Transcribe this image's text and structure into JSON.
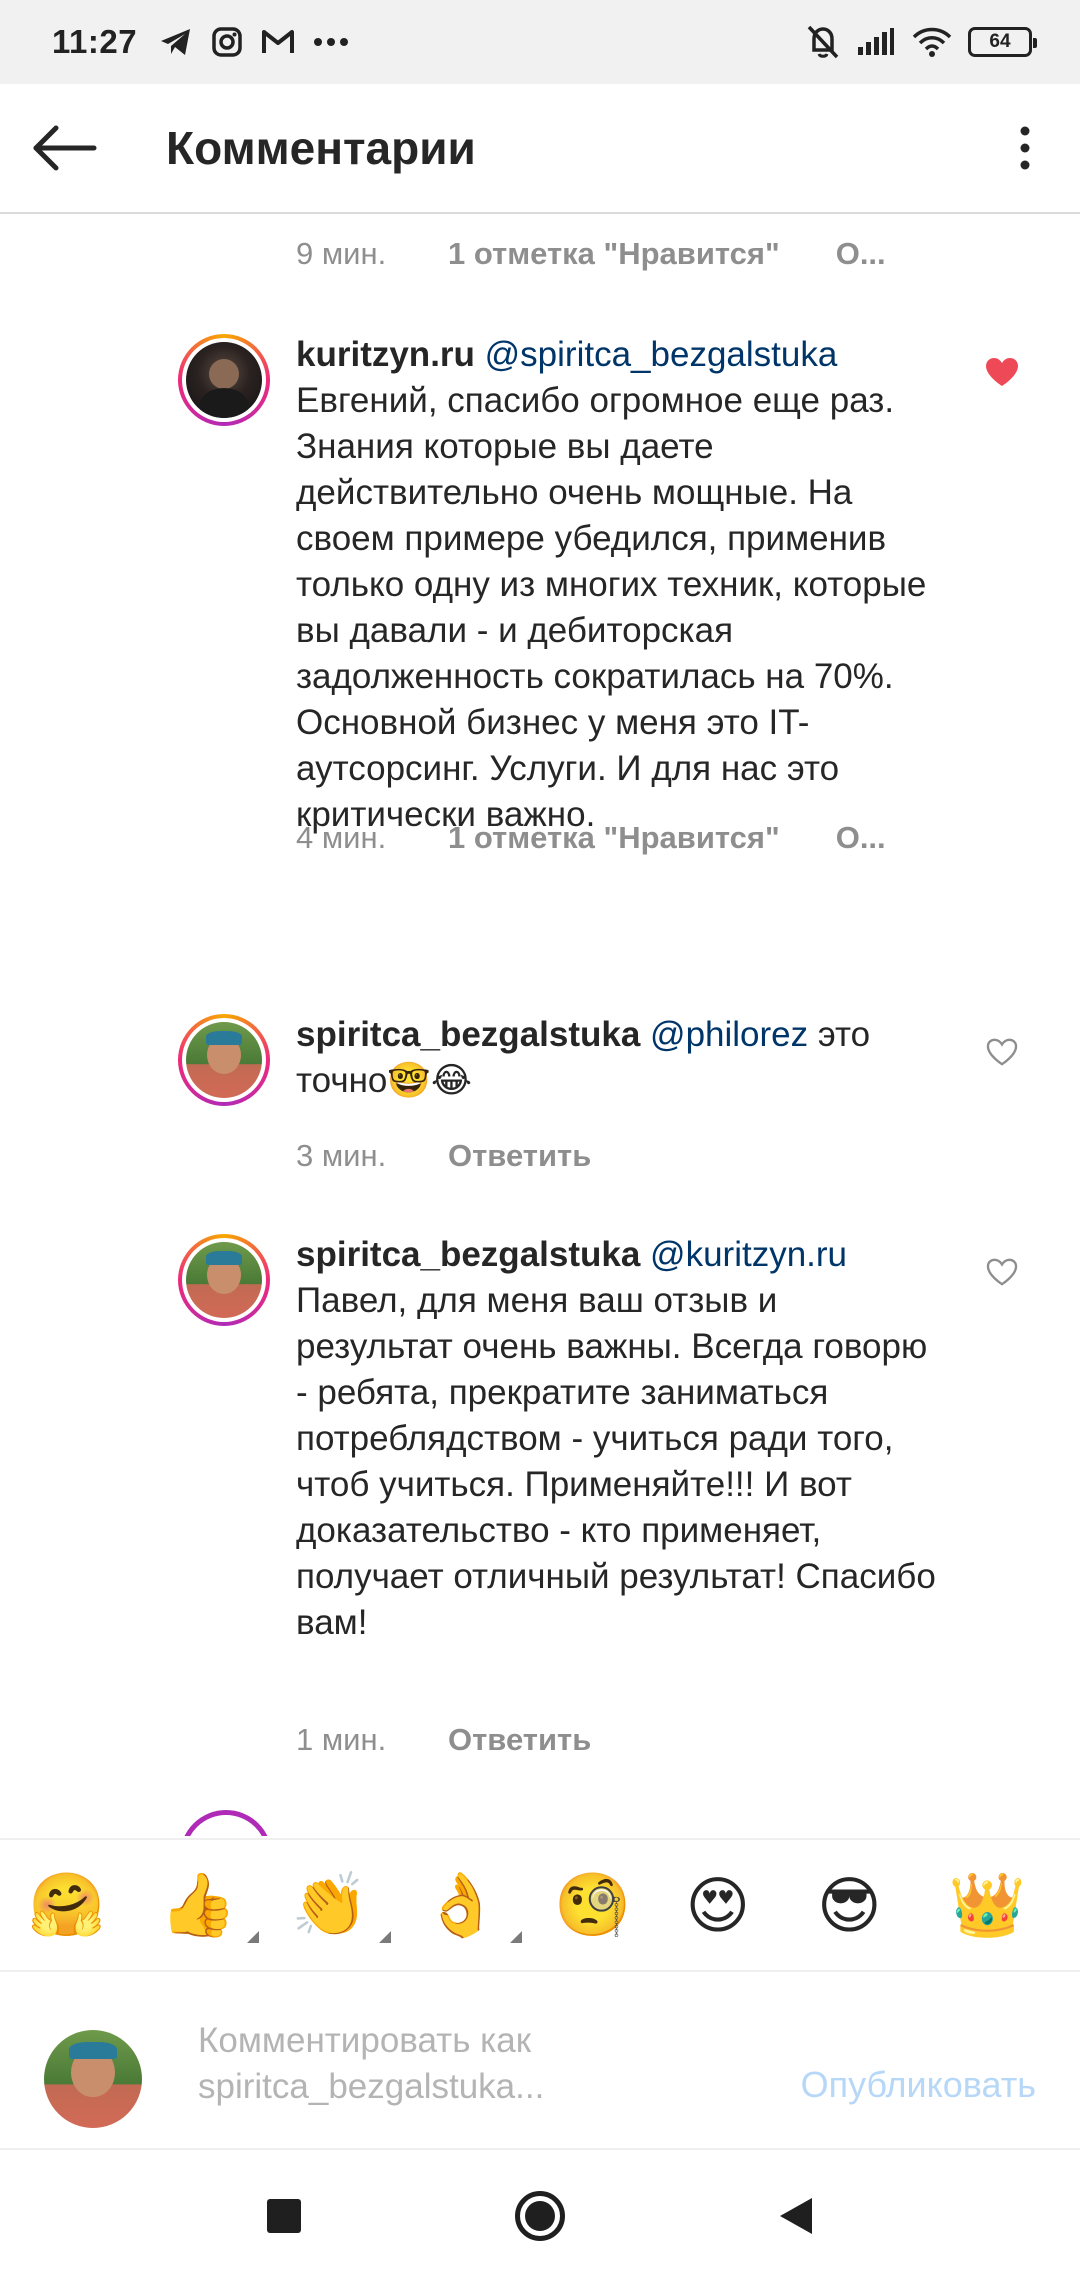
{
  "status": {
    "time": "11:27",
    "battery": "64",
    "left_icons": [
      "telegram-icon",
      "instagram-icon",
      "gmail-icon",
      "more-dots-icon"
    ],
    "right_icons": [
      "mute-bell-icon",
      "signal-icon",
      "wifi-icon",
      "battery-icon"
    ]
  },
  "header": {
    "title": "Комментарии"
  },
  "comments": [
    {
      "time": "9 мин.",
      "likes": "1 отметка \"Нравится\"",
      "action": "О..."
    },
    {
      "username": "kuritzyn.ru",
      "mention": "@spiritca_bezgalstuka",
      "text": "Евгений, спасибо огромное еще раз. Знания которые вы даете действительно очень мощные. На своем примере убедился, применив только одну из многих техник, которые вы давали - и дебиторская задолженность сократилась на 70%. Основной бизнес у меня это IT-аутсорсинг. Услуги. И для нас это критически важно.",
      "time": "4 мин.",
      "likes": "1 отметка \"Нравится\"",
      "action": "О...",
      "liked": true
    },
    {
      "username": "spiritca_bezgalstuka",
      "mention": "@philorez",
      "text": " это точно🤓😂",
      "time": "3 мин.",
      "action": "Ответить",
      "liked": false
    },
    {
      "username": "spiritca_bezgalstuka",
      "mention": "@kuritzyn.ru",
      "text": "Павел, для меня ваш отзыв и результат очень важны. Всегда говорю - ребята, прекратите заниматься потреблядством - учиться ради того, чтоб учиться. Применяйте!!! И вот доказательство - кто применяет, получает отличный результат! Спасибо вам!",
      "time": "1 мин.",
      "action": "Ответить",
      "liked": false
    }
  ],
  "emoji_bar": [
    "🤗",
    "👍",
    "👏",
    "👌",
    "🧐",
    "😍",
    "😎",
    "👑"
  ],
  "composer": {
    "placeholder": "Комментировать как spiritca_bezgalstuka...",
    "publish_label": "Опубликовать"
  },
  "colors": {
    "like_red": "#ed4956",
    "mention_blue": "#003569",
    "publish_disabled": "#b6d7f7"
  }
}
